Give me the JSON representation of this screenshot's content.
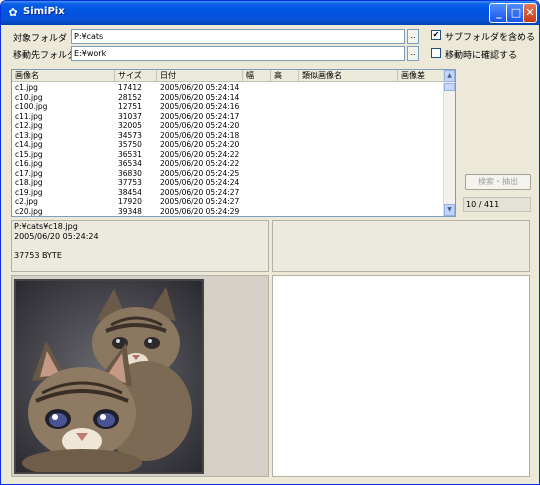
{
  "window": {
    "title": "SimiPix",
    "app_icon": "paw-icon"
  },
  "form": {
    "source_folder_label": "対象フォルダ",
    "source_folder_value": "P:¥cats",
    "dest_folder_label": "移動先フォルダ",
    "dest_folder_value": "E:¥work",
    "browse_label": "..",
    "include_subfolders_label": "サブフォルダを含める",
    "include_subfolders_checked": true,
    "confirm_on_move_label": "移動時に確認する",
    "confirm_on_move_checked": false
  },
  "list": {
    "columns": [
      "画像名",
      "サイズ",
      "日付",
      "幅",
      "高",
      "類似画像名",
      "画像差"
    ],
    "rows": [
      [
        "c1.jpg",
        "17412",
        "2005/06/20 05:24:14"
      ],
      [
        "c10.jpg",
        "28152",
        "2005/06/20 05:24:14"
      ],
      [
        "c100.jpg",
        "12751",
        "2005/06/20 05:24:16"
      ],
      [
        "c11.jpg",
        "31037",
        "2005/06/20 05:24:17"
      ],
      [
        "c12.jpg",
        "32005",
        "2005/06/20 05:24:20"
      ],
      [
        "c13.jpg",
        "34573",
        "2005/06/20 05:24:18"
      ],
      [
        "c14.jpg",
        "35750",
        "2005/06/20 05:24:20"
      ],
      [
        "c15.jpg",
        "36531",
        "2005/06/20 05:24:22"
      ],
      [
        "c16.jpg",
        "36534",
        "2005/06/20 05:24:22"
      ],
      [
        "c17.jpg",
        "36830",
        "2005/06/20 05:24:25"
      ],
      [
        "c18.jpg",
        "37753",
        "2005/06/20 05:24:24"
      ],
      [
        "c19.jpg",
        "38454",
        "2005/06/20 05:24:27"
      ],
      [
        "c2.jpg",
        "17920",
        "2005/06/20 05:24:27"
      ],
      [
        "c20.jpg",
        "39348",
        "2005/06/20 05:24:29"
      ]
    ]
  },
  "actions": {
    "search_label": "検索・抽出",
    "counter": "10 / 411"
  },
  "selected": {
    "path": "P:¥cats¥c18.jpg",
    "date": "2005/06/20 05:24:24",
    "size": "37753 BYTE"
  },
  "colors": {
    "titlebar": "#0054e3",
    "face": "#ece9d8"
  }
}
